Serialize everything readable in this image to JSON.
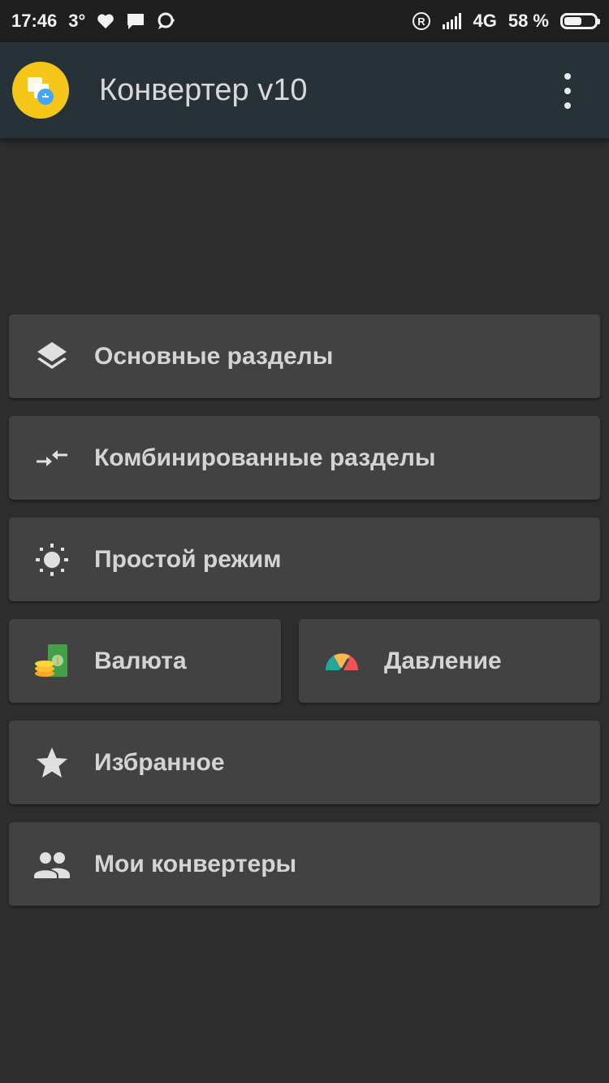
{
  "status_bar": {
    "time": "17:46",
    "temperature": "3°",
    "network": "4G",
    "battery_percent": "58 %",
    "battery_level": 0.58
  },
  "app_bar": {
    "title": "Конвертер v10",
    "logo_color": "#f5c518"
  },
  "menu": {
    "items": [
      {
        "label": "Основные разделы",
        "icon": "layers-icon"
      },
      {
        "label": "Комбинированные разделы",
        "icon": "compare-arrows-icon"
      },
      {
        "label": "Простой режим",
        "icon": "sun-icon"
      },
      {
        "label": "Валюта",
        "icon": "currency-icon"
      },
      {
        "label": "Давление",
        "icon": "gauge-icon"
      },
      {
        "label": "Избранное",
        "icon": "star-icon"
      },
      {
        "label": "Мои конвертеры",
        "icon": "people-icon"
      }
    ]
  },
  "colors": {
    "background": "#2d2d2d",
    "app_bar": "#263238",
    "card": "#424242"
  }
}
